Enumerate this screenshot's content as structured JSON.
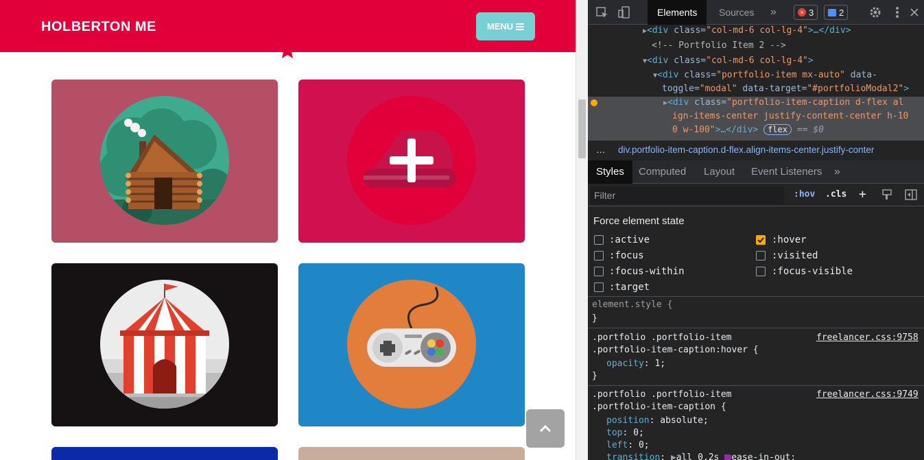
{
  "site": {
    "brand": "HOLBERTON ME",
    "menu_label": "MENU",
    "cards": [
      {
        "name": "cabin",
        "bg": "#b44f66"
      },
      {
        "name": "cake",
        "bg": "#d0104f"
      },
      {
        "name": "circus",
        "bg": "#161213"
      },
      {
        "name": "game",
        "bg": "#1f87c6"
      }
    ]
  },
  "devtools": {
    "tabs": [
      "Elements",
      "Sources"
    ],
    "errors_count": "3",
    "messages_count": "2",
    "dom": {
      "line1_tag": "<div",
      "line1_attr": " class=",
      "line1_val": "\"col-md-6 col-lg-4\"",
      "line1_end": ">…</div>",
      "comment": "<!-- Portfolio Item 2 -->",
      "line3_tag": "<div",
      "line3_attr": " class=",
      "line3_val": "\"col-md-6 col-lg-4\"",
      "line3_end": ">",
      "line4_tag": "<div",
      "line4_attr": " class=",
      "line4_val": "\"portfolio-item mx-auto\"",
      "line4_attr2": " data-",
      "line5_attr": "toggle=",
      "line5_val": "\"modal\"",
      "line5_attr2": " data-target=",
      "line5_val2": "\"#portfolioModal2\"",
      "line5_end": ">",
      "sel_tag": "<div",
      "sel_attr": " class=",
      "sel_val": "\"portfolio-item-caption d-flex al",
      "sel_val2": "ign-items-center justify-content-center h-10",
      "sel_val3": "0 w-100\"",
      "sel_end": ">…</div>",
      "sel_badge": "flex",
      "sel_eq": "== $0"
    },
    "breadcrumb": "div.portfolio-item-caption.d-flex.align-items-center.justify-conter",
    "style_tabs": [
      "Styles",
      "Computed",
      "Layout",
      "Event Listeners"
    ],
    "filter_placeholder": "Filter",
    "hov_label": ":hov",
    "cls_label": ".cls",
    "force_state_title": "Force element state",
    "states_left": [
      ":active",
      ":focus",
      ":focus-within",
      ":target"
    ],
    "states_right": [
      ":hover",
      ":visited",
      ":focus-visible"
    ],
    "hover_checked": true,
    "rules": {
      "element_style": "element.style {",
      "close": "}",
      "r1_sel1": ".portfolio .portfolio-item",
      "r1_sel2": ".portfolio-item-caption:hover {",
      "r1_src": "freelancer.css:9758",
      "r1_prop": "opacity",
      "r1_val": "1;",
      "r2_sel1": ".portfolio .portfolio-item",
      "r2_sel2": ".portfolio-item-caption {",
      "r2_src": "freelancer.css:9749",
      "r2_p1": "position",
      "r2_v1": "absolute;",
      "r2_p2": "top",
      "r2_v2": "0;",
      "r2_p3": "left",
      "r2_v3": "0;",
      "r2_p4": "transition",
      "r2_v4": "all 0.2s",
      "r2_v4b": "ease-in-out;"
    }
  }
}
